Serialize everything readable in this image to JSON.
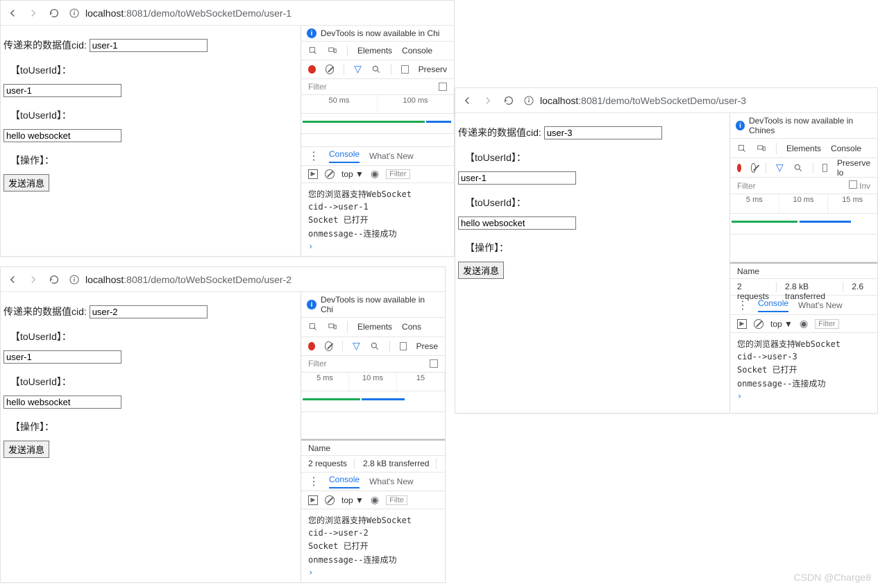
{
  "watermark": "CSDN @Charge8",
  "devtools_common": {
    "banner_prefix": "DevTools is now available in Chi",
    "banner_prefix2": "DevTools is now available in Chines",
    "elements": "Elements",
    "console": "Console",
    "conso": "Conso",
    "cons": "Cons",
    "preserve": "Preserv",
    "preserve2": "Preserve lo",
    "preserve3": "Prese",
    "filter": "Filter",
    "name": "Name",
    "whatsnew": "What's New",
    "top": "top ▼",
    "filter_box": "Filter",
    "filter_box2": "Filte",
    "inv": "Inv"
  },
  "page_common": {
    "cid_label": "传递来的数据值cid:",
    "to_user_label": "【toUserId】：",
    "op_label": "【操作】：",
    "send_btn": "发送消息"
  },
  "windows": [
    {
      "url_host": "localhost",
      "url_path": ":8081/demo/toWebSocketDemo/user-1",
      "cid_value": "user-1",
      "field1": "user-1",
      "field2": "hello websocket",
      "timeline": [
        "50 ms",
        "100 ms"
      ],
      "console": [
        "您的浏览器支持WebSocket",
        "cid-->user-1",
        "Socket 已打开",
        "onmessage--连接成功"
      ]
    },
    {
      "url_host": "localhost",
      "url_path": ":8081/demo/toWebSocketDemo/user-2",
      "cid_value": "user-2",
      "field1": "user-1",
      "field2": "hello websocket",
      "timeline": [
        "5 ms",
        "10 ms",
        "15"
      ],
      "summary": [
        "2 requests",
        "2.8 kB transferred"
      ],
      "console": [
        "您的浏览器支持WebSocket",
        "cid-->user-2",
        "Socket 已打开",
        "onmessage--连接成功"
      ]
    },
    {
      "url_host": "localhost",
      "url_path": ":8081/demo/toWebSocketDemo/user-3",
      "cid_value": "user-3",
      "field1": "user-1",
      "field2": "hello websocket",
      "timeline": [
        "5 ms",
        "10 ms",
        "15 ms"
      ],
      "summary": [
        "2 requests",
        "2.8 kB transferred",
        "2.6"
      ],
      "console": [
        "您的浏览器支持WebSocket",
        "cid-->user-3",
        "Socket 已打开",
        "onmessage--连接成功"
      ]
    }
  ]
}
